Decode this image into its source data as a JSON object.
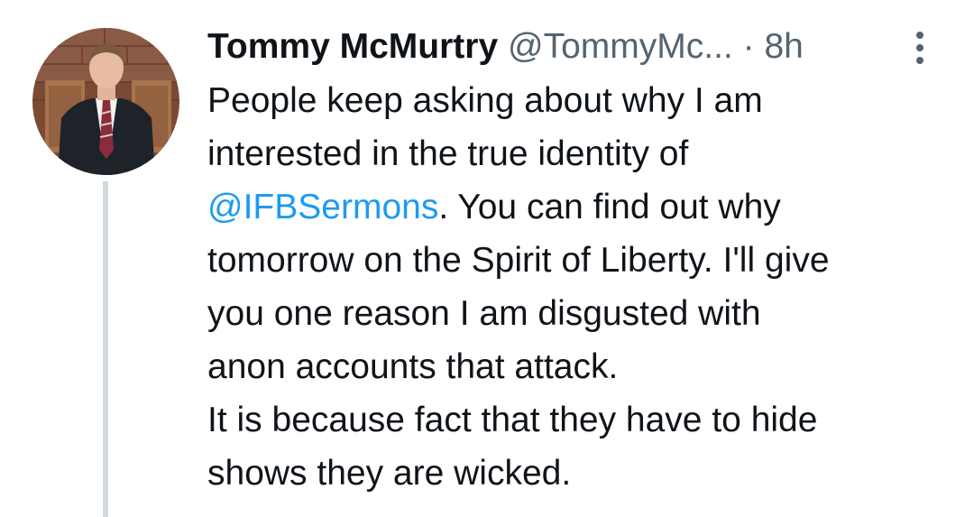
{
  "author": {
    "display_name": "Tommy McMurtry",
    "handle": "@TommyMc...",
    "separator": "·",
    "timestamp": "8h"
  },
  "icons": {
    "more": "more-vertical-icon"
  },
  "tweet": {
    "lines": [
      {
        "text": "People keep asking about why I am"
      },
      {
        "text": "interested in the true identity of"
      },
      {
        "mention": "@IFBSermons",
        "rest": ". You can find out why"
      },
      {
        "text": "tomorrow on the Spirit of Liberty. I'll give"
      },
      {
        "text": "you one reason I am disgusted with"
      },
      {
        "text": "anon accounts that attack."
      },
      {
        "text": "It is because fact that they have to hide"
      },
      {
        "text": "shows they are wicked."
      }
    ]
  },
  "colors": {
    "text": "#0f1419",
    "secondary": "#536471",
    "mention": "#1d9bf0",
    "thread_line": "#cfd9de"
  }
}
